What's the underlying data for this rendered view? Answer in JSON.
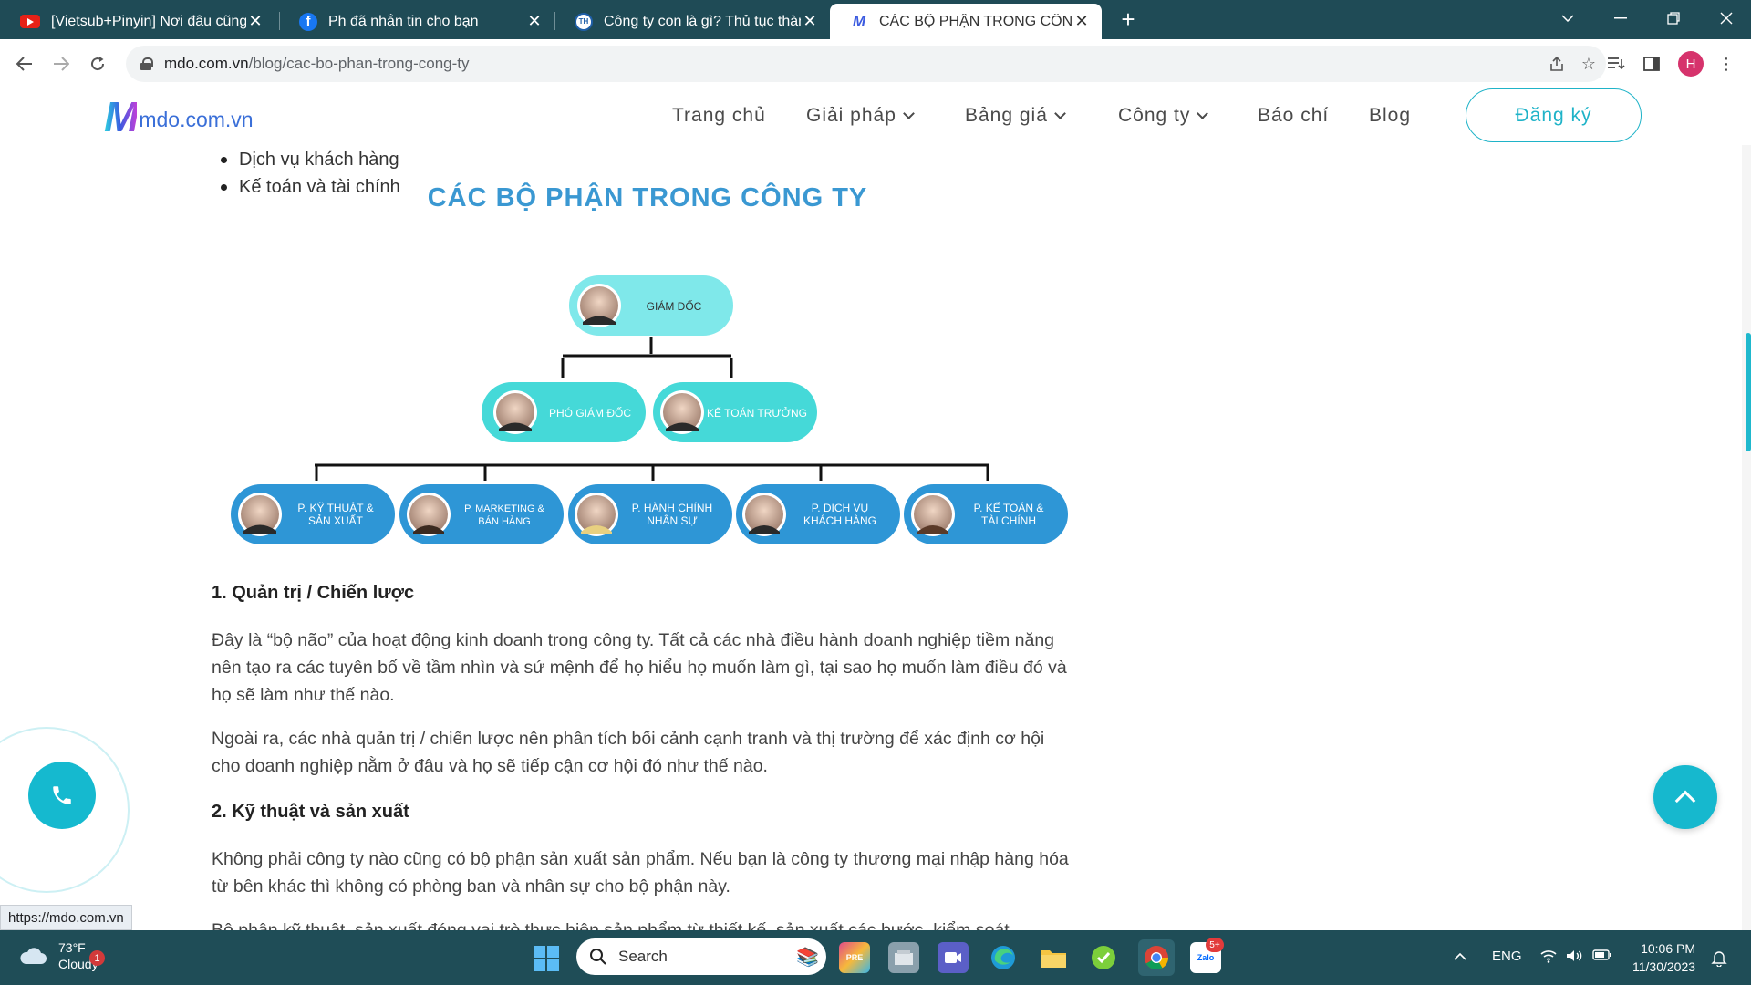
{
  "browser": {
    "tabs": [
      {
        "title": "[Vietsub+Pinyin] Nơi đâu cũng t",
        "icon": "youtube-icon",
        "active": false
      },
      {
        "title": "Ph đã nhắn tin cho bạn",
        "icon": "facebook-icon",
        "active": false
      },
      {
        "title": "Công ty con là gì? Thủ tục thành",
        "icon": "site-icon",
        "active": false
      },
      {
        "title": "CÁC BỘ PHẬN TRONG CÔNG TY",
        "icon": "mdo-icon",
        "active": true
      }
    ],
    "tab_icon_labels": {
      "site": "TH",
      "mdo": "M"
    },
    "url_host": "mdo.com.vn",
    "url_path": "/blog/cac-bo-phan-trong-cong-ty",
    "profile_initial": "H"
  },
  "site": {
    "logo_mark": "M",
    "logo_text": "mdo.com.vn",
    "nav": [
      {
        "label": "Trang chủ",
        "dropdown": false
      },
      {
        "label": "Giải pháp",
        "dropdown": true
      },
      {
        "label": "Bảng giá",
        "dropdown": true
      },
      {
        "label": "Công ty",
        "dropdown": true
      },
      {
        "label": "Báo chí",
        "dropdown": false
      },
      {
        "label": "Blog",
        "dropdown": false
      }
    ],
    "signup_label": "Đăng ký"
  },
  "article": {
    "bullets": [
      "Dịch vụ khách hàng",
      "Kế toán và tài chính"
    ],
    "org_chart": {
      "title": "CÁC BỘ PHẬN TRONG CÔNG TY",
      "level1": [
        "GIÁM ĐỐC"
      ],
      "level2": [
        "PHÓ GIÁM ĐỐC",
        "KẾ TOÁN TRƯỞNG"
      ],
      "level3": [
        [
          "P. KỸ THUẬT &",
          "SẢN XUẤT"
        ],
        [
          "P. MARKETING &",
          "BÁN HÀNG"
        ],
        [
          "P. HÀNH CHÍNH",
          "NHÂN SỰ"
        ],
        [
          "P. DỊCH VỤ",
          "KHÁCH HÀNG"
        ],
        [
          "P. KẾ TOÁN &",
          "TÀI CHÍNH"
        ]
      ],
      "colors": {
        "level1": "#7fe8ea",
        "level2": "#45d9d8",
        "level3": "#2e96d6",
        "title": "#3a98d2"
      }
    },
    "section1": {
      "heading": "1. Quản trị / Chiến lược",
      "p1": "Đây là “bộ não” của hoạt động kinh doanh trong công ty. Tất cả các nhà điều hành doanh nghiệp tiềm năng nên tạo ra các tuyên bố về tầm nhìn và sứ mệnh để họ hiểu họ muốn làm gì, tại sao họ muốn làm điều đó và họ sẽ làm như thế nào.",
      "p2": "Ngoài ra, các nhà quản trị / chiến lược nên phân tích bối cảnh cạnh tranh và thị trường để xác định cơ hội cho doanh nghiệp nằm ở đâu và họ sẽ tiếp cận cơ hội đó như thế nào."
    },
    "section2": {
      "heading": "2. Kỹ thuật và sản xuất",
      "p1": "Không phải công ty nào cũng có bộ phận sản xuất sản phẩm. Nếu bạn là công ty thương mại nhập hàng hóa từ bên khác thì không có phòng ban và nhân sự cho bộ phận này.",
      "p2_partial": "Bộ phận kỹ thuật, sản xuất đóng vai trò thực hiện sản phẩm từ thiết kế, sản xuất các bước, kiểm soát"
    }
  },
  "status_url": "https://mdo.com.vn",
  "taskbar": {
    "temperature": "73°F",
    "weather": "Cloudy",
    "weather_badge": "1",
    "search_placeholder": "Search",
    "zalo_badge": "5+",
    "zalo_label": "Zalo",
    "pre_label": "PRE",
    "language": "ENG",
    "time": "10:06 PM",
    "date": "11/30/2023"
  }
}
